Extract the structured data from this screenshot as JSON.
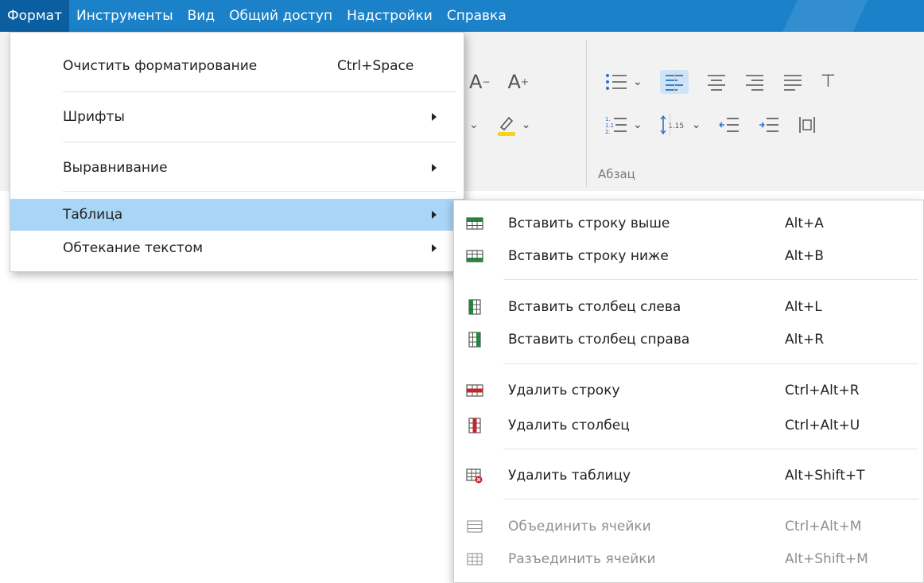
{
  "menubar": {
    "items": [
      {
        "label": "Формат",
        "active": true
      },
      {
        "label": "Инструменты"
      },
      {
        "label": "Вид"
      },
      {
        "label": "Общий доступ"
      },
      {
        "label": "Надстройки"
      },
      {
        "label": "Справка"
      }
    ]
  },
  "toolbar": {
    "group_label": "Абзац",
    "line_spacing_value": "1.15"
  },
  "format_menu": {
    "items": [
      {
        "label": "Очистить форматирование",
        "shortcut": "Ctrl+Space"
      },
      {
        "label": "Шрифты"
      },
      {
        "label": "Выравнивание"
      },
      {
        "label": "Таблица"
      },
      {
        "label": "Обтекание текстом"
      }
    ]
  },
  "table_submenu": {
    "items": [
      {
        "label": "Вставить строку выше",
        "shortcut": "Alt+A",
        "icon": "insert-row-above-icon"
      },
      {
        "label": "Вставить строку ниже",
        "shortcut": "Alt+B",
        "icon": "insert-row-below-icon"
      },
      {
        "label": "Вставить столбец слева",
        "shortcut": "Alt+L",
        "icon": "insert-column-left-icon"
      },
      {
        "label": "Вставить столбец справа",
        "shortcut": "Alt+R",
        "icon": "insert-column-right-icon"
      },
      {
        "label": "Удалить строку",
        "shortcut": "Ctrl+Alt+R",
        "icon": "delete-row-icon"
      },
      {
        "label": "Удалить столбец",
        "shortcut": "Ctrl+Alt+U",
        "icon": "delete-column-icon"
      },
      {
        "label": "Удалить таблицу",
        "shortcut": "Alt+Shift+T",
        "icon": "delete-table-icon"
      },
      {
        "label": "Объединить ячейки",
        "shortcut": "Ctrl+Alt+M",
        "icon": "merge-cells-icon",
        "disabled": true
      },
      {
        "label": "Разъединить ячейки",
        "shortcut": "Alt+Shift+M",
        "icon": "split-cells-icon",
        "disabled": true
      }
    ]
  },
  "colors": {
    "menubar": "#1b81c9",
    "menubar_active": "#0b5fa0",
    "highlight": "#a9d5f6",
    "insert_icon": "#1e8a3c",
    "delete_icon": "#d0212a"
  }
}
